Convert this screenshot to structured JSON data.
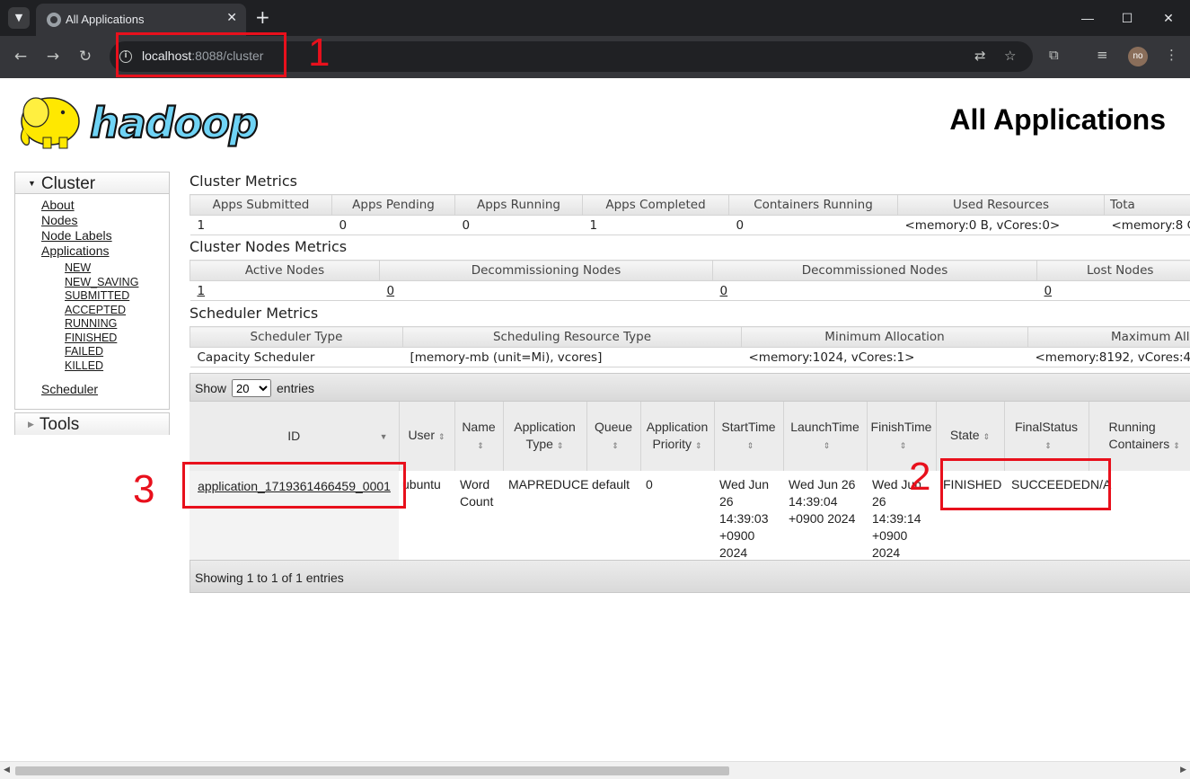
{
  "browser": {
    "tab_title": "All Applications",
    "url_host": "localhost",
    "url_rest": ":8088/cluster",
    "profile_initials": "no"
  },
  "page": {
    "title": "All Applications"
  },
  "sidebar": {
    "cluster_label": "Cluster",
    "links": [
      "About",
      "Nodes",
      "Node Labels",
      "Applications"
    ],
    "app_states": [
      "NEW",
      "NEW_SAVING",
      "SUBMITTED",
      "ACCEPTED",
      "RUNNING",
      "FINISHED",
      "FAILED",
      "KILLED"
    ],
    "scheduler_label": "Scheduler",
    "tools_label": "Tools"
  },
  "cluster_metrics": {
    "title": "Cluster Metrics",
    "headers": [
      "Apps Submitted",
      "Apps Pending",
      "Apps Running",
      "Apps Completed",
      "Containers Running",
      "Used Resources",
      "Tota"
    ],
    "values": [
      "1",
      "0",
      "0",
      "1",
      "0",
      "<memory:0 B, vCores:0>",
      "<memory:8 G"
    ]
  },
  "nodes_metrics": {
    "title": "Cluster Nodes Metrics",
    "headers": [
      "Active Nodes",
      "Decommissioning Nodes",
      "Decommissioned Nodes",
      "Lost Nodes"
    ],
    "values": [
      "1",
      "0",
      "0",
      "0"
    ]
  },
  "scheduler_metrics": {
    "title": "Scheduler Metrics",
    "headers": [
      "Scheduler Type",
      "Scheduling Resource Type",
      "Minimum Allocation",
      "Maximum All"
    ],
    "values": [
      "Capacity Scheduler",
      "[memory-mb (unit=Mi), vcores]",
      "<memory:1024, vCores:1>",
      "<memory:8192, vCores:4>"
    ]
  },
  "apps_table": {
    "show_label": "Show",
    "page_size": "20",
    "entries_label": "entries",
    "headers": [
      "ID",
      "User",
      "Name",
      "Application Type",
      "Queue",
      "Application Priority",
      "StartTime",
      "LaunchTime",
      "FinishTime",
      "State",
      "FinalStatus",
      "Running Containers"
    ],
    "row": {
      "id": "application_1719361466459_0001",
      "user": "ubuntu",
      "name": "Word Count",
      "type": "MAPREDUCE",
      "queue": "default",
      "priority": "0",
      "start": "Wed Jun 26 14:39:03 +0900 2024",
      "launch": "Wed Jun 26 14:39:04 +0900 2024",
      "finish": "Wed Jun 26 14:39:14 +0900 2024",
      "state": "FINISHED",
      "final_status": "SUCCEEDED",
      "running_containers": "N/A"
    },
    "footer": "Showing 1 to 1 of 1 entries"
  },
  "annotations": [
    "1",
    "2",
    "3"
  ],
  "colors": {
    "annotation_red": "#e8101c",
    "chrome_dark": "#1f2023"
  }
}
